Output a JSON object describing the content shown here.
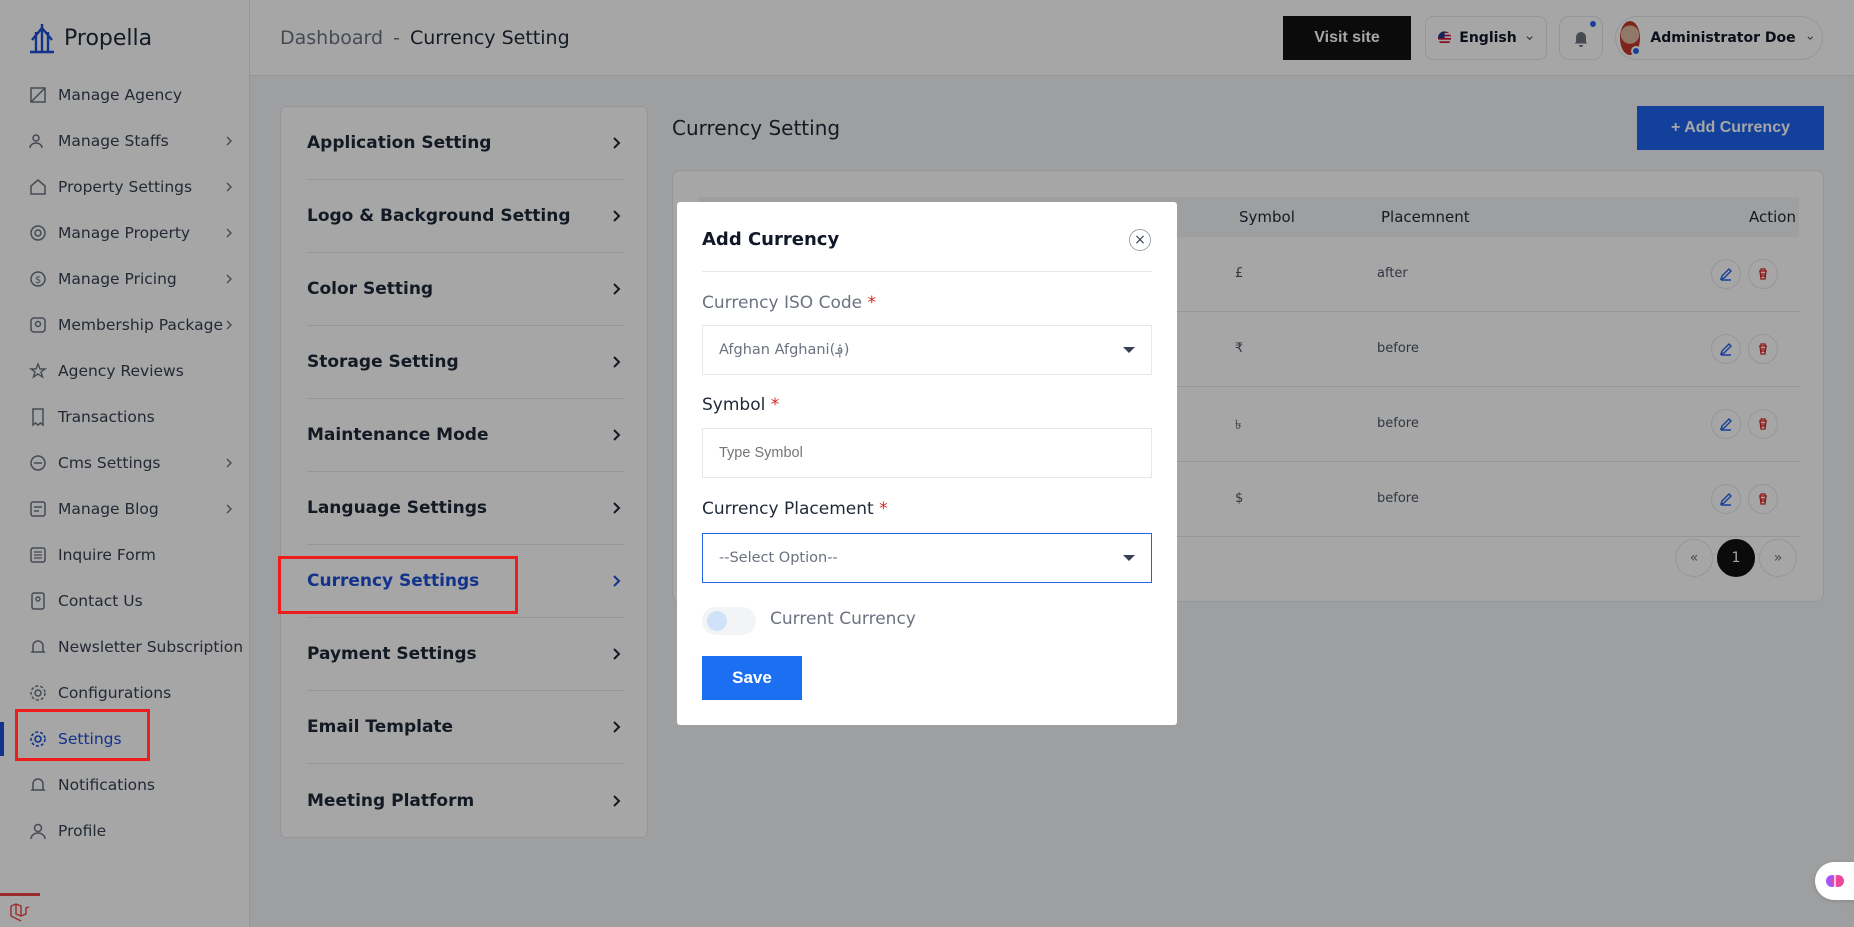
{
  "brand": {
    "name": "Propella"
  },
  "sidebar": {
    "items": [
      {
        "label": "Manage Agency",
        "icon": "agency-icon",
        "has_children": false
      },
      {
        "label": "Manage Staffs",
        "icon": "users-icon",
        "has_children": true
      },
      {
        "label": "Property Settings",
        "icon": "home-icon",
        "has_children": true
      },
      {
        "label": "Manage Property",
        "icon": "building-icon",
        "has_children": true
      },
      {
        "label": "Manage Pricing",
        "icon": "dollar-icon",
        "has_children": true
      },
      {
        "label": "Membership Package",
        "icon": "badge-icon",
        "has_children": true
      },
      {
        "label": "Agency Reviews",
        "icon": "star-icon",
        "has_children": false
      },
      {
        "label": "Transactions",
        "icon": "receipt-icon",
        "has_children": false
      },
      {
        "label": "Cms Settings",
        "icon": "cms-icon",
        "has_children": true
      },
      {
        "label": "Manage Blog",
        "icon": "blog-icon",
        "has_children": true
      },
      {
        "label": "Inquire Form",
        "icon": "form-icon",
        "has_children": false
      },
      {
        "label": "Contact Us",
        "icon": "contact-icon",
        "has_children": false
      },
      {
        "label": "Newsletter Subscription",
        "icon": "bell-icon",
        "has_children": false
      },
      {
        "label": "Configurations",
        "icon": "cog-icon",
        "has_children": false
      },
      {
        "label": "Settings",
        "icon": "gear-icon",
        "has_children": false,
        "active": true
      },
      {
        "label": "Notifications",
        "icon": "bell-icon",
        "has_children": false
      },
      {
        "label": "Profile",
        "icon": "user-icon",
        "has_children": false
      }
    ]
  },
  "header": {
    "breadcrumb_root": "Dashboard",
    "breadcrumb_sep": "-",
    "breadcrumb_current": "Currency Setting",
    "visit_site": "Visit site",
    "language": "English",
    "user_name": "Administrator Doe"
  },
  "settings_menu": {
    "items": [
      {
        "label": "Application Setting"
      },
      {
        "label": "Logo & Background Setting"
      },
      {
        "label": "Color Setting"
      },
      {
        "label": "Storage Setting"
      },
      {
        "label": "Maintenance Mode"
      },
      {
        "label": "Language Settings"
      },
      {
        "label": "Currency Settings",
        "active": true
      },
      {
        "label": "Payment Settings"
      },
      {
        "label": "Email Template"
      },
      {
        "label": "Meeting Platform"
      }
    ]
  },
  "main": {
    "title": "Currency Setting",
    "add_button": "+ Add Currency",
    "table": {
      "columns": [
        "Symbol",
        "Placemnent",
        "Action"
      ],
      "rows": [
        {
          "symbol": "£",
          "placement": "after"
        },
        {
          "symbol": "₹",
          "placement": "before"
        },
        {
          "symbol": "৳",
          "placement": "before"
        },
        {
          "symbol": "$",
          "placement": "before"
        }
      ]
    },
    "pagination": {
      "prev": "«",
      "current": "1",
      "next": "»"
    }
  },
  "modal": {
    "title": "Add Currency",
    "close": "×",
    "iso_label": "Currency ISO Code",
    "iso_value": "Afghan Afghani(؋)",
    "symbol_label": "Symbol",
    "symbol_placeholder": "Type Symbol",
    "placement_label": "Currency Placement",
    "placement_value": "--Select Option--",
    "required_mark": "*",
    "toggle_label": "Current Currency",
    "save": "Save"
  },
  "colors": {
    "accent": "#1d4ed8",
    "highlight": "#ef1c1c",
    "danger": "#dc2626"
  }
}
